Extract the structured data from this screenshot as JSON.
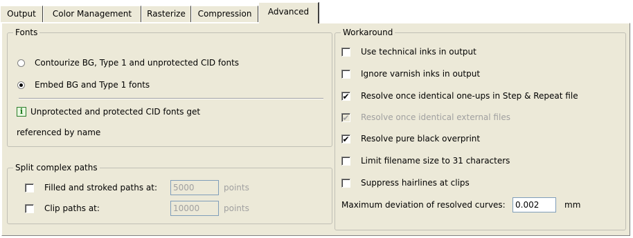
{
  "tabs": [
    {
      "label": "Output",
      "active": false
    },
    {
      "label": "Color Management",
      "active": false
    },
    {
      "label": "Rasterize",
      "active": false
    },
    {
      "label": "Compression",
      "active": false
    },
    {
      "label": "Advanced",
      "active": true
    }
  ],
  "fonts": {
    "title": "Fonts",
    "options": [
      {
        "label": "Contourize BG, Type 1 and unprotected CID fonts",
        "selected": false
      },
      {
        "label": "Embed BG and Type 1 fonts",
        "selected": true
      }
    ],
    "info_icon": "info-icon",
    "info_line1": "Unprotected and protected CID fonts get",
    "info_line2": "referenced by name"
  },
  "split": {
    "title": "Split complex paths",
    "filled": {
      "label": "Filled and stroked paths at:",
      "checked": false,
      "value": "5000",
      "unit": "points"
    },
    "clip": {
      "label": "Clip paths at:",
      "checked": false,
      "value": "10000",
      "unit": "points"
    }
  },
  "workaround": {
    "title": "Workaround",
    "items": [
      {
        "label": "Use technical inks in output",
        "checked": false,
        "disabled": false
      },
      {
        "label": "Ignore varnish inks in output",
        "checked": false,
        "disabled": false
      },
      {
        "label": "Resolve once identical one-ups in Step & Repeat file",
        "checked": true,
        "disabled": false
      },
      {
        "label": "Resolve once identical external files",
        "checked": true,
        "disabled": true
      },
      {
        "label": "Resolve pure black overprint",
        "checked": true,
        "disabled": false
      },
      {
        "label": "Limit filename size to 31 characters",
        "checked": false,
        "disabled": false
      },
      {
        "label": "Suppress hairlines at clips",
        "checked": false,
        "disabled": false
      }
    ],
    "deviation_label": "Maximum deviation of resolved curves:",
    "deviation_value": "0.002",
    "deviation_unit": "mm"
  }
}
